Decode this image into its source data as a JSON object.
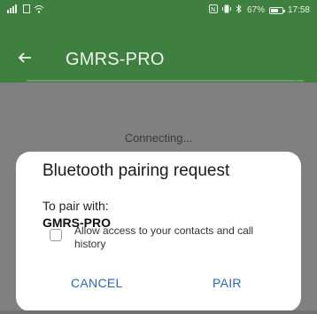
{
  "status_bar": {
    "left_icons": [
      "signal-icon",
      "sim-icon",
      "wifi-icon"
    ],
    "right_icons": [
      "nfc-icon",
      "vibrate-icon",
      "bluetooth-icon"
    ],
    "battery": "67%",
    "battery_level": 0.67,
    "time": "17:58"
  },
  "app_bar": {
    "back_icon": "arrow-left-icon",
    "title": "GMRS-PRO"
  },
  "progress": {
    "fraction": 1.0
  },
  "main": {
    "status_text": "Connecting..."
  },
  "dialog": {
    "title": "Bluetooth pairing request",
    "pair_with_label": "To pair with:",
    "device_name": "GMRS-PRO",
    "checkbox": {
      "label": "Allow access to your contacts and call history",
      "checked": false
    },
    "cancel_label": "CANCEL",
    "pair_label": "PAIR"
  },
  "colors": {
    "header_bg": "#3f7f3f",
    "dim_overlay": "#808080",
    "button_text": "#2f66b5"
  }
}
